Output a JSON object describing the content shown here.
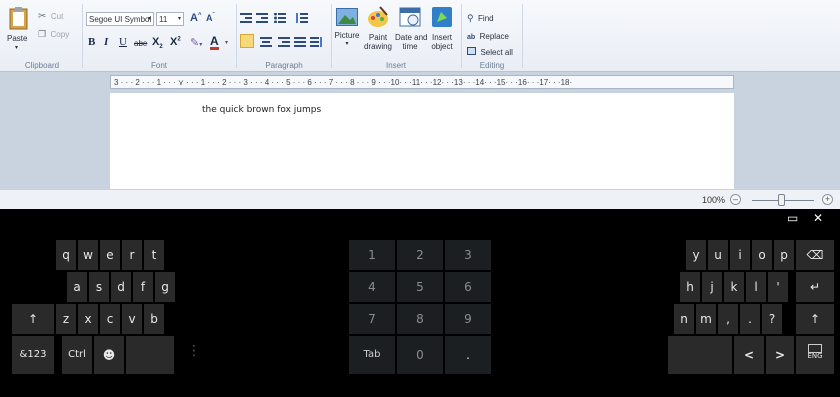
{
  "ribbon": {
    "clipboard": {
      "paste": "Paste",
      "cut": "Cut",
      "copy": "Copy",
      "label": "Clipboard"
    },
    "font": {
      "family": "Segoe UI Symbol",
      "size": "11",
      "label": "Font",
      "bold": "B",
      "italic": "I",
      "underline": "U",
      "strike": "abe"
    },
    "paragraph": {
      "label": "Paragraph"
    },
    "insert": {
      "picture": "Picture",
      "paint_drawing_1": "Paint",
      "paint_drawing_2": "drawing",
      "date_time_1": "Date and",
      "date_time_2": "time",
      "insert_object_1": "Insert",
      "insert_object_2": "object",
      "label": "Insert"
    },
    "editing": {
      "find": "Find",
      "replace": "Replace",
      "select_all": "Select all",
      "label": "Editing"
    }
  },
  "ruler": {
    "ticks": "3 · · · 2 · · · 1 · · · ⋎ · · · 1 · · · 2 · · · 3 · · · 4 · · · 5 · · · 6 · · · 7 · · · 8 · · · 9 · · ·10· · ·11· · ·12· · ·13· · ·14· · ·15· · ·16· · ·17· · ·18·"
  },
  "document": {
    "text": "the quick brown fox jumps"
  },
  "status": {
    "zoom": "100%"
  },
  "keyboard": {
    "left": {
      "row1": [
        "q",
        "w",
        "e",
        "r",
        "t"
      ],
      "row2": [
        "a",
        "s",
        "d",
        "f",
        "g"
      ],
      "row3": [
        "z",
        "x",
        "c",
        "v",
        "b"
      ],
      "shift": "↑",
      "sym": "&123",
      "ctrl": "Ctrl",
      "emoji": "☻"
    },
    "numpad": {
      "row1": [
        "1",
        "2",
        "3"
      ],
      "row2": [
        "4",
        "5",
        "6"
      ],
      "row3": [
        "7",
        "8",
        "9"
      ],
      "tab": "Tab",
      "zero": "0",
      "dot": "."
    },
    "right": {
      "row1": [
        "y",
        "u",
        "i",
        "o",
        "p"
      ],
      "backspace": "⌫",
      "row2": [
        "h",
        "j",
        "k",
        "l",
        "'"
      ],
      "enter": "↵",
      "row3": [
        "n",
        "m",
        ",",
        ".",
        "?"
      ],
      "shift": "↑",
      "left_arrow": "<",
      "right_arrow": ">",
      "lang": "ENG"
    },
    "controls": {
      "minimize": "▭",
      "close": "✕"
    }
  }
}
